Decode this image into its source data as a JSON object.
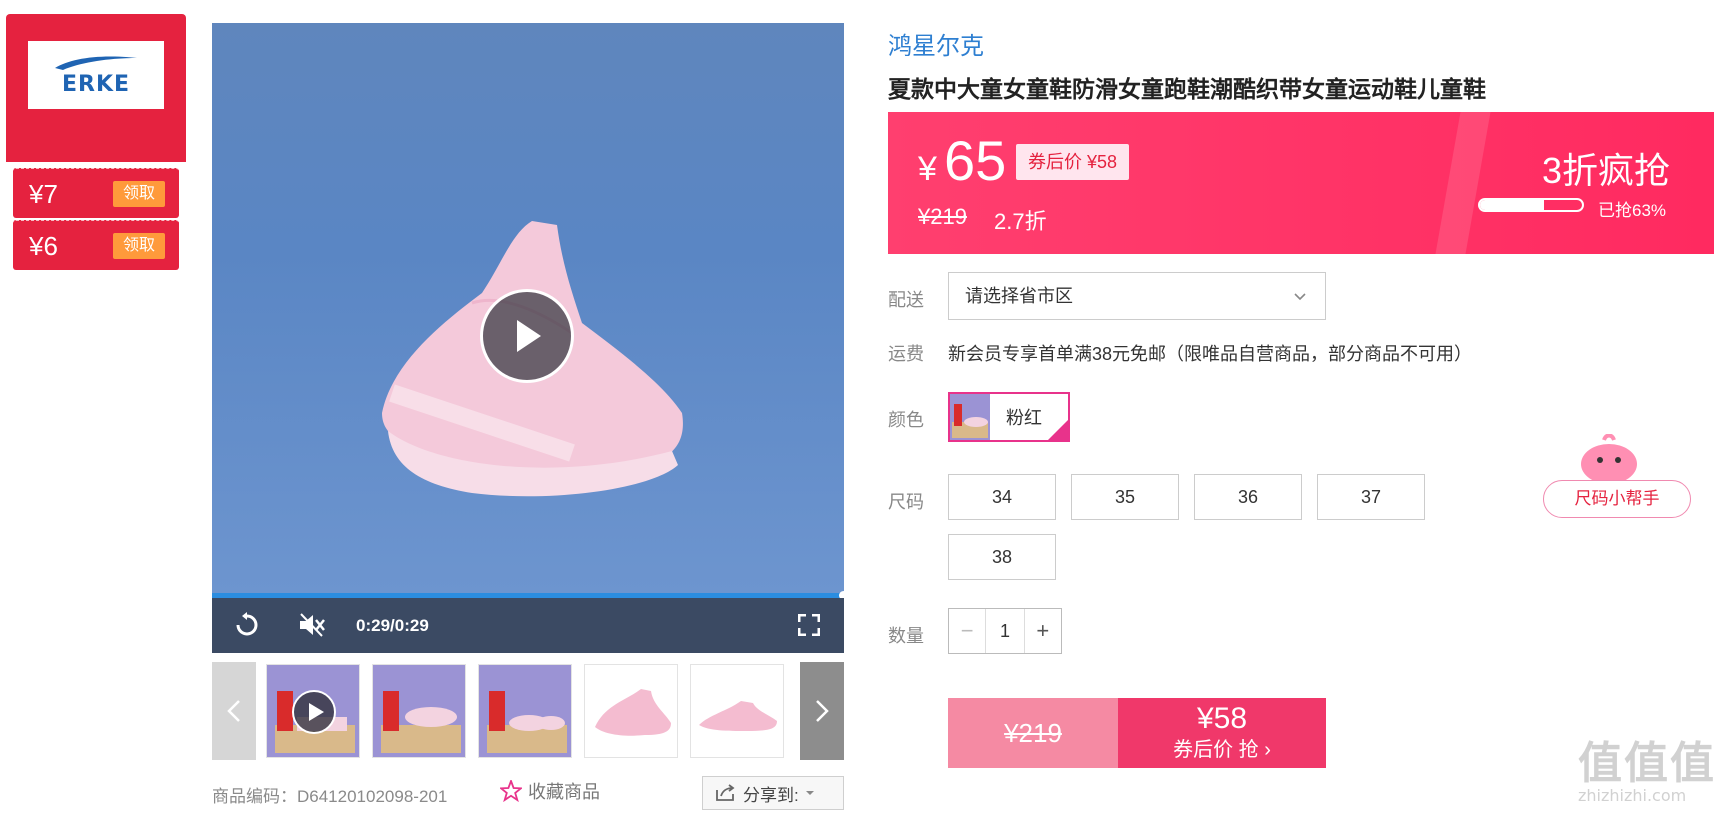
{
  "brand_panel": {
    "logo_text": "ERKE",
    "coupons": [
      {
        "amount": "¥7",
        "action": "领取"
      },
      {
        "amount": "¥6",
        "action": "领取"
      }
    ]
  },
  "video": {
    "time": "0:29/0:29",
    "progress": 1.0
  },
  "product_meta": {
    "sku": "商品编码：D64120102098-201",
    "favorite_label": "收藏商品",
    "share_label": "分享到:"
  },
  "product": {
    "brand": "鸿星尔克",
    "title": "夏款中大童女童鞋防滑女童跑鞋潮酷织带女童运动鞋儿童鞋",
    "price": {
      "currency": "¥",
      "current": "65",
      "after_coupon": "券后价 ¥58",
      "original": "¥219",
      "discount": "2.7折",
      "promo": "3折疯抢",
      "sold_text": "已抢63%",
      "sold_ratio": 0.63
    },
    "delivery": {
      "label": "配送",
      "placeholder": "请选择省市区"
    },
    "shipping": {
      "label": "运费",
      "text": "新会员专享首单满38元免邮（限唯品自营商品，部分商品不可用）"
    },
    "color": {
      "label": "颜色",
      "selected": "粉红"
    },
    "size": {
      "label": "尺码",
      "options": [
        "34",
        "35",
        "36",
        "37",
        "38"
      ],
      "helper": "尺码小帮手"
    },
    "quantity": {
      "label": "数量",
      "value": "1",
      "minus": "−",
      "plus": "+"
    },
    "buy": {
      "original": "¥219",
      "price": "¥58",
      "action": "券后价 抢 ›"
    }
  },
  "watermark": {
    "big": "值值值",
    "small": "zhizhizhi.com"
  },
  "colors": {
    "brand_red": "#e5223f",
    "price_band": "#ff2a60",
    "coupon_orange": "#ff9a3b",
    "link_blue": "#2e7fd1",
    "select_pink": "#e8338b"
  }
}
